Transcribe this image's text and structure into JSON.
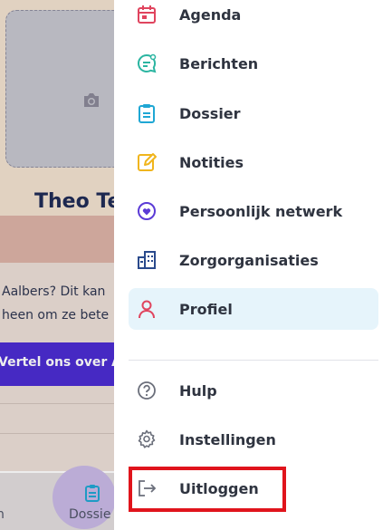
{
  "background_page": {
    "name_partial": "Theo Te",
    "text_line1": "Aalbers? Dit kan",
    "text_line2": "heen om ze bete",
    "cta_label": "Vertel ons over A",
    "bottom_nav_left_label": "n",
    "bottom_nav_label": "Dossie"
  },
  "menu": {
    "items": [
      {
        "label": "Agenda",
        "icon": "calendar-icon",
        "color": "#e0445e"
      },
      {
        "label": "Berichten",
        "icon": "chat-icon",
        "color": "#2bb5a1"
      },
      {
        "label": "Dossier",
        "icon": "clipboard-icon",
        "color": "#1fa7d4"
      },
      {
        "label": "Notities",
        "icon": "pencil-icon",
        "color": "#f0b51d"
      },
      {
        "label": "Persoonlijk netwerk",
        "icon": "heart-circle-icon",
        "color": "#5b3bd6"
      },
      {
        "label": "Zorgorganisaties",
        "icon": "building-icon",
        "color": "#2a4a8c"
      },
      {
        "label": "Profiel",
        "icon": "person-icon",
        "color": "#e0445e",
        "active": true
      }
    ],
    "secondary": [
      {
        "label": "Hulp",
        "icon": "help-icon"
      },
      {
        "label": "Instellingen",
        "icon": "gear-icon"
      },
      {
        "label": "Uitloggen",
        "icon": "logout-icon"
      }
    ]
  },
  "colors": {
    "active_bg": "#e6f4fb",
    "highlight_border": "#e0141c",
    "cta_bg": "#4a2bd2"
  }
}
